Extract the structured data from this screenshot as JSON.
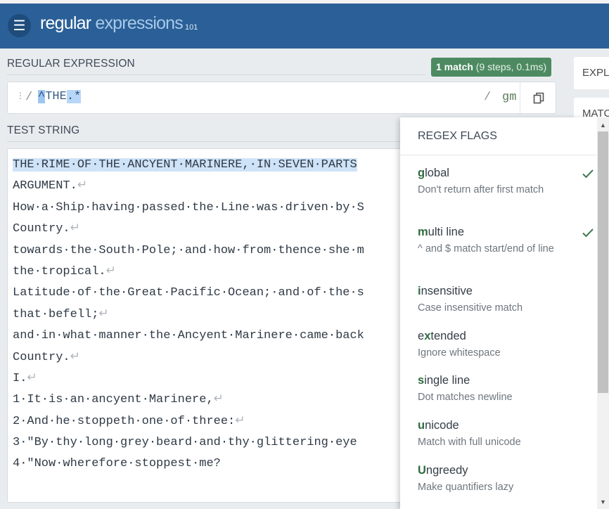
{
  "app": {
    "brand_word1": "regular",
    "brand_word2": " expressions",
    "brand_version": "101"
  },
  "icons": {
    "menu": "hamburger-icon",
    "copy": "copy-icon",
    "drag": "drag-handle-icon",
    "check": "checkmark-icon"
  },
  "regex": {
    "section_title": "REGULAR EXPRESSION",
    "match_count": "1 match",
    "match_detail": " (9 steps, 0.1ms)",
    "open_delim": "/",
    "tokens": [
      "^",
      "THE",
      ".*"
    ],
    "close_delim": "/",
    "flags": "gm"
  },
  "test": {
    "section_title": "TEST STRING",
    "lines": [
      {
        "text": "THE·RIME·OF·THE·ANCYENT·MARINERE,·IN·SEVEN·PARTS",
        "end": ""
      },
      {
        "text": "ARGUMENT.",
        "end": "↵"
      },
      {
        "text": "How·a·Ship·having·passed·the·Line·was·driven·by·S",
        "end": ""
      },
      {
        "text": "Country.",
        "end": "↵"
      },
      {
        "text": "towards·the·South·Pole;·and·how·from·thence·she·m",
        "end": ""
      },
      {
        "text": "the·tropical.",
        "end": "↵"
      },
      {
        "text": "Latitude·of·the·Great·Pacific·Ocean;·and·of·the·s",
        "end": ""
      },
      {
        "text": "that·befell;",
        "end": "↵"
      },
      {
        "text": "and·in·what·manner·the·Ancyent·Marinere·came·back",
        "end": ""
      },
      {
        "text": "Country.",
        "end": "↵"
      },
      {
        "text": "I.",
        "end": "↵"
      },
      {
        "text": "1·It·is·an·ancyent·Marinere,",
        "end": "↵"
      },
      {
        "text": "2·And·he·stoppeth·one·of·three:",
        "end": "↵"
      },
      {
        "text": "3·\"By·thy·long·grey·beard·and·thy·glittering·eye",
        "end": ""
      },
      {
        "text": "4·\"Now·wherefore·stoppest·me?",
        "end": ""
      }
    ]
  },
  "side": {
    "card1": "EXPL",
    "card2": "MATC"
  },
  "flags_panel": {
    "title": "REGEX FLAGS",
    "items": [
      {
        "key": "g",
        "rest": "lobal",
        "desc": "Don't return after first match",
        "checked": true
      },
      {
        "key": "m",
        "rest": "ulti line",
        "desc": "^ and $ match start/end of line",
        "checked": true
      },
      {
        "key": "i",
        "rest": "nsensitive",
        "desc": "Case insensitive match",
        "checked": false
      },
      {
        "key": "x",
        "pre": "e",
        "rest": "tended",
        "desc": "Ignore whitespace",
        "checked": false
      },
      {
        "key": "s",
        "rest": "ingle line",
        "desc": "Dot matches newline",
        "checked": false
      },
      {
        "key": "u",
        "rest": "nicode",
        "desc": "Match with full unicode",
        "checked": false
      },
      {
        "key": "U",
        "rest": "ngreedy",
        "desc": "Make quantifiers lazy",
        "checked": false
      }
    ]
  },
  "colors": {
    "header": "#2a6097",
    "match_badge": "#4d8a61",
    "flag_key": "#2f6b3f",
    "match_highlight": "#cfe3f8"
  }
}
